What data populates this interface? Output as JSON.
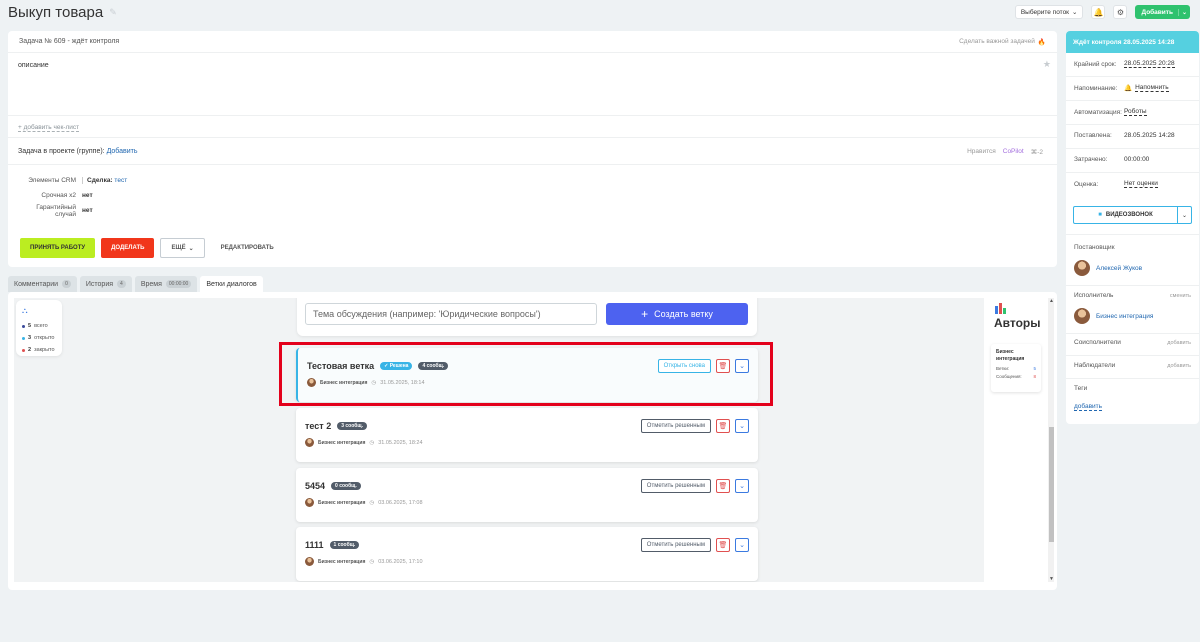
{
  "page": {
    "title": "Выкуп товара"
  },
  "topbar": {
    "flow_select": "Выберите поток",
    "add_button": "Добавить"
  },
  "task": {
    "header": "Задача № 609 - ждёт контроля",
    "make_important": "Сделать важной задачей",
    "description": "описание",
    "add_checklist": "+ добавить чек-лист",
    "in_project_label": "Задача в проекте (группе):",
    "in_project_link": "Добавить",
    "likes": "Нравится",
    "copilot": "CoPilot",
    "copilot_count": "⌘-2",
    "fields": [
      {
        "label": "Элементы CRM",
        "prefix": "Сделка:",
        "value": "тест"
      },
      {
        "label": "Срочная x2",
        "value": "нет"
      },
      {
        "label": "Гарантийный случай",
        "value": "нет"
      }
    ],
    "actions": {
      "accept": "ПРИНЯТЬ РАБОТУ",
      "redo": "ДОДЕЛАТЬ",
      "more": "ЕЩЁ",
      "edit": "РЕДАКТИРОВАТЬ"
    }
  },
  "tabs": [
    {
      "label": "Комментарии",
      "count": "0"
    },
    {
      "label": "История",
      "count": "4"
    },
    {
      "label": "Время",
      "count": "00:00:00"
    },
    {
      "label": "Ветки диалогов",
      "count": ""
    }
  ],
  "stats": {
    "total": "5",
    "total_label": "всего",
    "open": "3",
    "open_label": "открыто",
    "closed": "2",
    "closed_label": "закрыто"
  },
  "new_thread": {
    "placeholder": "Тема обсуждения (например: 'Юридические вопросы')",
    "create": "Создать ветку"
  },
  "threads": [
    {
      "name": "Тестовая ветка",
      "solved_badge": "Решена",
      "count_badge": "4 сообщ.",
      "author": "Бизнес интеграция",
      "time": "31.05.2025, 18:14",
      "action": "Открыть снова"
    },
    {
      "name": "тест 2",
      "count_badge": "3 сообщ.",
      "author": "Бизнес интеграция",
      "time": "31.05.2025, 18:24",
      "action": "Отметить решенным"
    },
    {
      "name": "5454",
      "count_badge": "0 сообщ.",
      "author": "Бизнес интеграция",
      "time": "03.06.2025, 17:08",
      "action": "Отметить решенным"
    },
    {
      "name": "1111",
      "count_badge": "1 сообщ.",
      "author": "Бизнес интеграция",
      "time": "03.06.2025, 17:10",
      "action": "Отметить решенным"
    }
  ],
  "authors": {
    "title": "Авторы",
    "name": "Бизнес интеграция",
    "threads_label": "Ветки:",
    "threads_value": "5",
    "messages_label": "Сообщения:",
    "messages_value": "8"
  },
  "sidebar": {
    "status": "Ждёт контроля 28.05.2025 14:28",
    "rows": [
      {
        "k": "Крайний срок:",
        "v": "28.05.2025 20:28"
      },
      {
        "k": "Напоминание:",
        "v": "Напомнить"
      },
      {
        "k": "Автоматизация:",
        "v": "Роботы"
      },
      {
        "k": "Поставлена:",
        "v": "28.05.2025 14:28"
      },
      {
        "k": "Затрачено:",
        "v": "00:00:00"
      },
      {
        "k": "Оценка:",
        "v": "Нет оценки"
      }
    ],
    "video": "ВИДЕОЗВОНОК",
    "creator_label": "Постановщик",
    "creator": "Алексей Жуков",
    "executor_label": "Исполнитель",
    "executor_change": "сменить",
    "executor": "Бизнес интеграция",
    "coexec_label": "Соисполнители",
    "coexec_add": "добавить",
    "observers_label": "Наблюдатели",
    "observers_add": "добавить",
    "tags_label": "Теги",
    "tags_add": "добавить"
  },
  "colors": {
    "accent_blue": "#4d62f0",
    "green": "#bbed21",
    "red": "#f1361b",
    "status": "#55d0e0",
    "highlight": "#e3001b"
  }
}
